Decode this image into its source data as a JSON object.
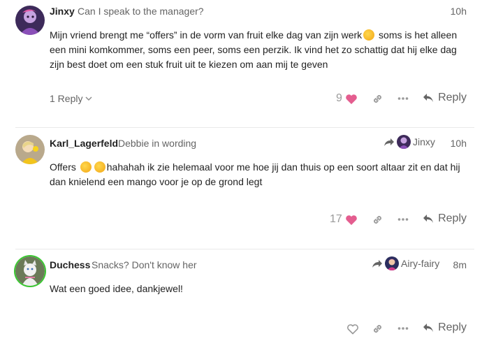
{
  "posts": [
    {
      "username": "Jinxy",
      "user_title": "Can I speak to the manager?",
      "time": "10h",
      "body_parts": [
        "Mijn vriend brengt me “offers” in de vorm van fruit elke dag van zijn werk",
        " soms is het alleen een mini komkommer, soms een peer, soms een perzik. Ik vind het zo schattig dat hij elke dag zijn best doet om een stuk fruit uit te kiezen om aan mij te geven"
      ],
      "replies_label": "1 Reply",
      "like_count": "9",
      "reply_label": "Reply"
    },
    {
      "username": "Karl_Lagerfeld",
      "user_title": "Debbie in wording",
      "reply_to": "Jinxy",
      "time": "10h",
      "body_parts": [
        "Offers ",
        "hahahah ik zie helemaal voor me hoe jij dan thuis op een soort altaar zit en dat hij dan knielend een mango voor je op de grond legt"
      ],
      "like_count": "17",
      "reply_label": "Reply"
    },
    {
      "username": "Duchess",
      "user_title": "Snacks? Don't know her",
      "reply_to": "Airy-fairy",
      "time": "8m",
      "body": "Wat een goed idee, dankjewel!",
      "reply_label": "Reply"
    }
  ],
  "colors": {
    "heart": "#e45d8f",
    "text_muted": "#646464",
    "divider": "#e9e9e9",
    "online_ring": "#3ac731"
  },
  "icons": [
    "heart-icon",
    "link-icon",
    "more-icon",
    "reply-arrow-icon",
    "chevron-down-icon",
    "reply-to-arrow-icon"
  ]
}
